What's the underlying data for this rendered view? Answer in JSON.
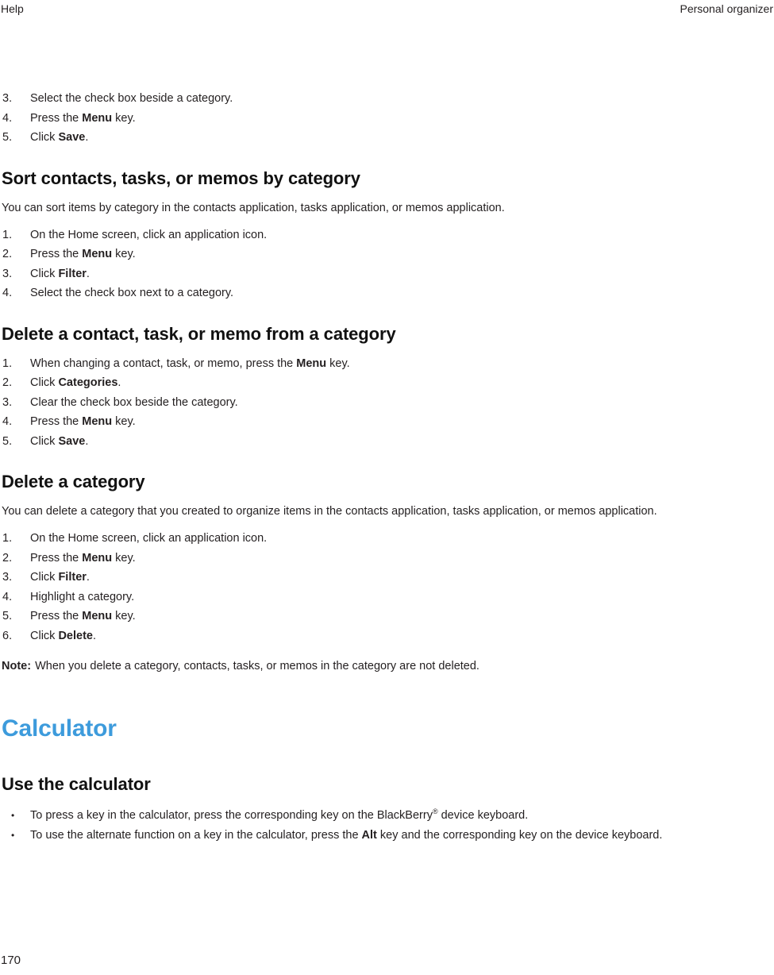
{
  "header": {
    "left": "Help",
    "right": "Personal organizer"
  },
  "footer": {
    "page_number": "170"
  },
  "colors": {
    "chapter_heading": "#3d9bdc",
    "body_text": "#231f20",
    "section_heading": "#111111",
    "page_background": "#ffffff"
  },
  "continued_list": {
    "items": [
      {
        "marker": "3.",
        "pre": "Select the check box beside a category.",
        "bold": "",
        "post": ""
      },
      {
        "marker": "4.",
        "pre": "Press the ",
        "bold": "Menu",
        "post": " key."
      },
      {
        "marker": "5.",
        "pre": "Click ",
        "bold": "Save",
        "post": "."
      }
    ]
  },
  "sections": [
    {
      "id": "sort-contacts-tasks-memos",
      "heading": "Sort contacts, tasks, or memos by category",
      "intro": "You can sort items by category in the contacts application, tasks application, or memos application.",
      "steps": [
        {
          "marker": "1.",
          "pre": "On the Home screen, click an application icon.",
          "bold": "",
          "post": ""
        },
        {
          "marker": "2.",
          "pre": "Press the ",
          "bold": "Menu",
          "post": " key."
        },
        {
          "marker": "3.",
          "pre": "Click ",
          "bold": "Filter",
          "post": "."
        },
        {
          "marker": "4.",
          "pre": "Select the check box next to a category.",
          "bold": "",
          "post": ""
        }
      ]
    },
    {
      "id": "delete-contact-task-memo",
      "heading": "Delete a contact, task, or memo from a category",
      "intro": "",
      "steps": [
        {
          "marker": "1.",
          "pre": "When changing a contact, task, or memo, press the ",
          "bold": "Menu",
          "post": " key."
        },
        {
          "marker": "2.",
          "pre": "Click ",
          "bold": "Categories",
          "post": "."
        },
        {
          "marker": "3.",
          "pre": "Clear the check box beside the category.",
          "bold": "",
          "post": ""
        },
        {
          "marker": "4.",
          "pre": "Press the ",
          "bold": "Menu",
          "post": " key."
        },
        {
          "marker": "5.",
          "pre": "Click ",
          "bold": "Save",
          "post": "."
        }
      ]
    },
    {
      "id": "delete-a-category",
      "heading": "Delete a category",
      "intro": "You can delete a category that you created to organize items in the contacts application, tasks application, or memos application.",
      "steps": [
        {
          "marker": "1.",
          "pre": "On the Home screen, click an application icon.",
          "bold": "",
          "post": ""
        },
        {
          "marker": "2.",
          "pre": "Press the ",
          "bold": "Menu",
          "post": " key."
        },
        {
          "marker": "3.",
          "pre": "Click ",
          "bold": "Filter",
          "post": "."
        },
        {
          "marker": "4.",
          "pre": "Highlight a category.",
          "bold": "",
          "post": ""
        },
        {
          "marker": "5.",
          "pre": "Press the ",
          "bold": "Menu",
          "post": " key."
        },
        {
          "marker": "6.",
          "pre": "Click ",
          "bold": "Delete",
          "post": "."
        }
      ],
      "note": {
        "label": "Note:",
        "text": "When you delete a category, contacts, tasks, or memos in the category are not deleted."
      }
    }
  ],
  "chapter": {
    "title": "Calculator",
    "section": {
      "id": "use-the-calculator",
      "heading": "Use the calculator",
      "bullets": [
        {
          "marker": "•",
          "pre": "To press a key in the calculator, press the corresponding key on the BlackBerry",
          "sup": "®",
          "bold": "",
          "post": " device keyboard."
        },
        {
          "marker": "•",
          "pre": "To use the alternate function on a key in the calculator, press the ",
          "sup": "",
          "bold": "Alt",
          "post": " key and the corresponding key on the device keyboard."
        }
      ]
    }
  }
}
